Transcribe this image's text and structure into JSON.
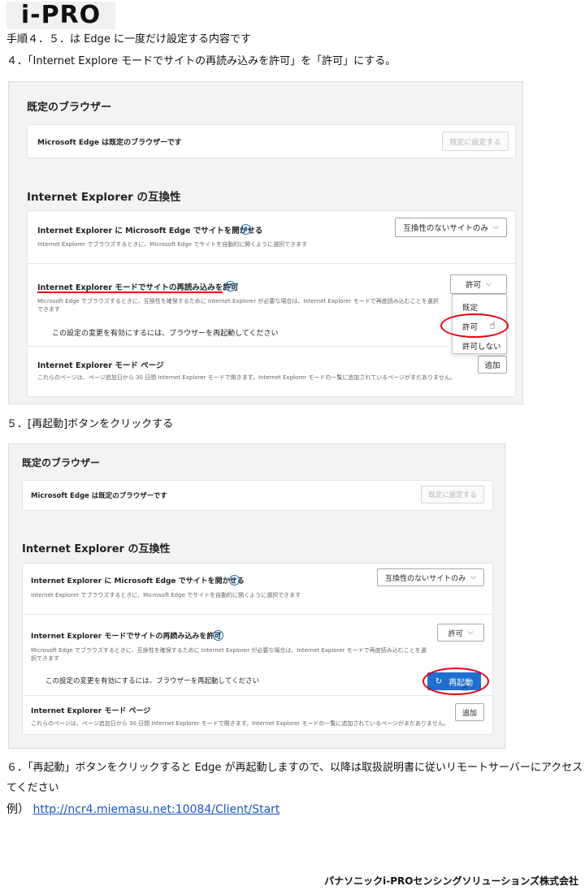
{
  "logo": {
    "text": "i-PRO"
  },
  "doc": {
    "intro": "手順４．５．は Edge に一度だけ設定する内容です",
    "step4": "４．「Internet Explore モードでサイトの再読み込みを許可」を「許可」にする。",
    "step5": "５．[再起動]ボタンをクリックする",
    "step6_line1": "６．「再起動」ボタンをクリックすると Edge が再起動しますので、以降は取扱説明書に従いリモートサーバーにアクセスし",
    "step6_line2": "てください",
    "example_prefix": "例）",
    "example_url": "http://ncr4.miemasu.net:10084/Client/Start",
    "footer": "パナソニックi-PROセンシングソリューションズ株式会社"
  },
  "settings": {
    "default_browser_title": "既定のブラウザー",
    "default_browser_text": "Microsoft Edge は既定のブラウザーです",
    "set_default_button": "既定に設定する",
    "ie_compat_title": "Internet Explorer の互換性",
    "open_in_edge_title": "Internet Explorer に Microsoft Edge でサイトを開かせる",
    "open_in_edge_desc": "Internet Explorer でブラウズするときに、Microsoft Edge でサイトを自動的に開くように選択できます",
    "open_in_edge_value": "互換性のないサイトのみ",
    "reload_title": "Internet Explorer モードでサイトの再読み込みを許可",
    "reload_desc": "Microsoft Edge でブラウズするときに、互換性を確保するために Internet Explorer が必要な場合は、Internet Explorer モードで再度読み込むことを選択できます",
    "reload_value": "許可",
    "restart_notice": "この設定の変更を有効にするには、ブラウザーを再起動してください",
    "restart_button": "再起動",
    "ie_pages_title": "Internet Explorer モード ページ",
    "ie_pages_desc": "これらのページは、ページ追加日から 30 日間 Internet Explorer モードで開きます。Internet Explorer モードの一覧に追加されているページがまだありません。",
    "add_button": "追加",
    "dropdown_options": [
      "既定",
      "許可",
      "許可しない"
    ],
    "help_icon": "?"
  },
  "colors": {
    "accent": "#1f6fd1",
    "annotation": "#e60012",
    "link": "#1a56c9"
  }
}
